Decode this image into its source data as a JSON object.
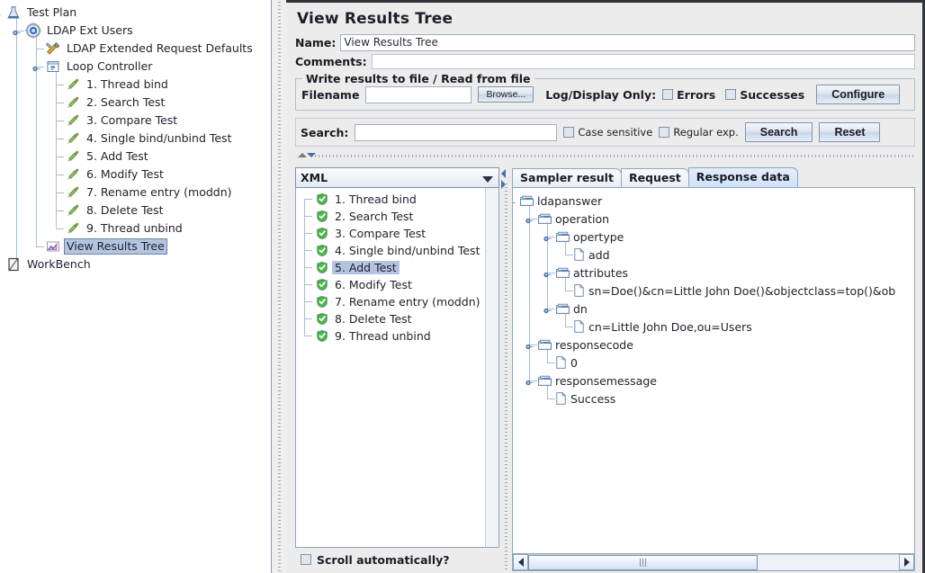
{
  "left_tree": {
    "nodes": [
      {
        "label": "Test Plan",
        "icon": "test-plan-icon",
        "depth": 0,
        "handle": true,
        "selected": false
      },
      {
        "label": "LDAP Ext Users",
        "icon": "thread-group-icon",
        "depth": 1,
        "handle": true,
        "selected": false
      },
      {
        "label": "LDAP Extended Request Defaults",
        "icon": "config-defaults-icon",
        "depth": 2,
        "handle": false,
        "selected": false
      },
      {
        "label": "Loop Controller",
        "icon": "loop-controller-icon",
        "depth": 2,
        "handle": true,
        "selected": false
      },
      {
        "label": "1. Thread bind",
        "icon": "sampler-icon",
        "depth": 3,
        "handle": false,
        "selected": false
      },
      {
        "label": "2. Search Test",
        "icon": "sampler-icon",
        "depth": 3,
        "handle": false,
        "selected": false
      },
      {
        "label": "3. Compare Test",
        "icon": "sampler-icon",
        "depth": 3,
        "handle": false,
        "selected": false
      },
      {
        "label": "4. Single bind/unbind Test",
        "icon": "sampler-icon",
        "depth": 3,
        "handle": false,
        "selected": false
      },
      {
        "label": "5. Add Test",
        "icon": "sampler-icon",
        "depth": 3,
        "handle": false,
        "selected": false
      },
      {
        "label": "6. Modify Test",
        "icon": "sampler-icon",
        "depth": 3,
        "handle": false,
        "selected": false
      },
      {
        "label": "7. Rename entry (moddn)",
        "icon": "sampler-icon",
        "depth": 3,
        "handle": false,
        "selected": false
      },
      {
        "label": "8. Delete Test",
        "icon": "sampler-icon",
        "depth": 3,
        "handle": false,
        "selected": false
      },
      {
        "label": "9. Thread unbind",
        "icon": "sampler-icon",
        "depth": 3,
        "handle": false,
        "selected": false
      },
      {
        "label": "View Results Tree",
        "icon": "view-results-tree-icon",
        "depth": 2,
        "handle": false,
        "selected": true
      },
      {
        "label": "WorkBench",
        "icon": "workbench-icon",
        "depth": 0,
        "handle": false,
        "selected": false
      }
    ]
  },
  "main": {
    "title": "View Results Tree",
    "name_label": "Name:",
    "name_value": "View Results Tree",
    "comments_label": "Comments:",
    "comments_value": "",
    "file_group": {
      "title": "Write results to file / Read from file",
      "filename_label": "Filename",
      "filename_value": "",
      "browse_label": "Browse...",
      "log_display_label": "Log/Display Only:",
      "errors_label": "Errors",
      "errors_checked": false,
      "successes_label": "Successes",
      "successes_checked": false,
      "configure_label": "Configure"
    },
    "search_bar": {
      "label": "Search:",
      "value": "",
      "case_sensitive_label": "Case sensitive",
      "case_sensitive_checked": false,
      "regular_exp_label": "Regular exp.",
      "regular_exp_checked": false,
      "search_button": "Search",
      "reset_button": "Reset"
    },
    "renderer_combo": {
      "selected": "XML"
    },
    "results": {
      "items": [
        {
          "label": "1. Thread bind",
          "status": "success",
          "selected": false
        },
        {
          "label": "2. Search Test",
          "status": "success",
          "selected": false
        },
        {
          "label": "3. Compare Test",
          "status": "success",
          "selected": false
        },
        {
          "label": "4. Single bind/unbind Test",
          "status": "success",
          "selected": false
        },
        {
          "label": "5. Add Test",
          "status": "success",
          "selected": true
        },
        {
          "label": "6. Modify Test",
          "status": "success",
          "selected": false
        },
        {
          "label": "7. Rename entry (moddn)",
          "status": "success",
          "selected": false
        },
        {
          "label": "8. Delete Test",
          "status": "success",
          "selected": false
        },
        {
          "label": "9. Thread unbind",
          "status": "success",
          "selected": false
        }
      ],
      "scroll_auto_label": "Scroll automatically?",
      "scroll_auto_checked": false
    },
    "tabs": [
      {
        "label": "Sampler result",
        "active": false
      },
      {
        "label": "Request",
        "active": false
      },
      {
        "label": "Response data",
        "active": true
      }
    ],
    "response_tree": {
      "nodes": [
        {
          "label": "ldapanswer",
          "type": "folder",
          "depth": 0,
          "handle": true
        },
        {
          "label": "operation",
          "type": "folder",
          "depth": 1,
          "handle": true
        },
        {
          "label": "opertype",
          "type": "folder",
          "depth": 2,
          "handle": true
        },
        {
          "label": "add",
          "type": "leaf",
          "depth": 3,
          "handle": false
        },
        {
          "label": "attributes",
          "type": "folder",
          "depth": 2,
          "handle": true
        },
        {
          "label": "sn=Doe()&cn=Little John Doe()&objectclass=top()&ob",
          "type": "leaf",
          "depth": 3,
          "handle": false
        },
        {
          "label": "dn",
          "type": "folder",
          "depth": 2,
          "handle": true
        },
        {
          "label": "cn=Little John Doe,ou=Users",
          "type": "leaf",
          "depth": 3,
          "handle": false
        },
        {
          "label": "responsecode",
          "type": "folder",
          "depth": 1,
          "handle": true
        },
        {
          "label": "0",
          "type": "leaf",
          "depth": 2,
          "handle": false
        },
        {
          "label": "responsemessage",
          "type": "folder",
          "depth": 1,
          "handle": true
        },
        {
          "label": "Success",
          "type": "leaf",
          "depth": 2,
          "handle": false
        }
      ]
    }
  },
  "colors": {
    "selection": "#b3c4e0",
    "panel_bg": "#ececec",
    "tree_line": "#a8bdd6",
    "success_green": "#2f9e2f",
    "tab_active": "#cfe2f6",
    "border": "#8fa6c0"
  }
}
